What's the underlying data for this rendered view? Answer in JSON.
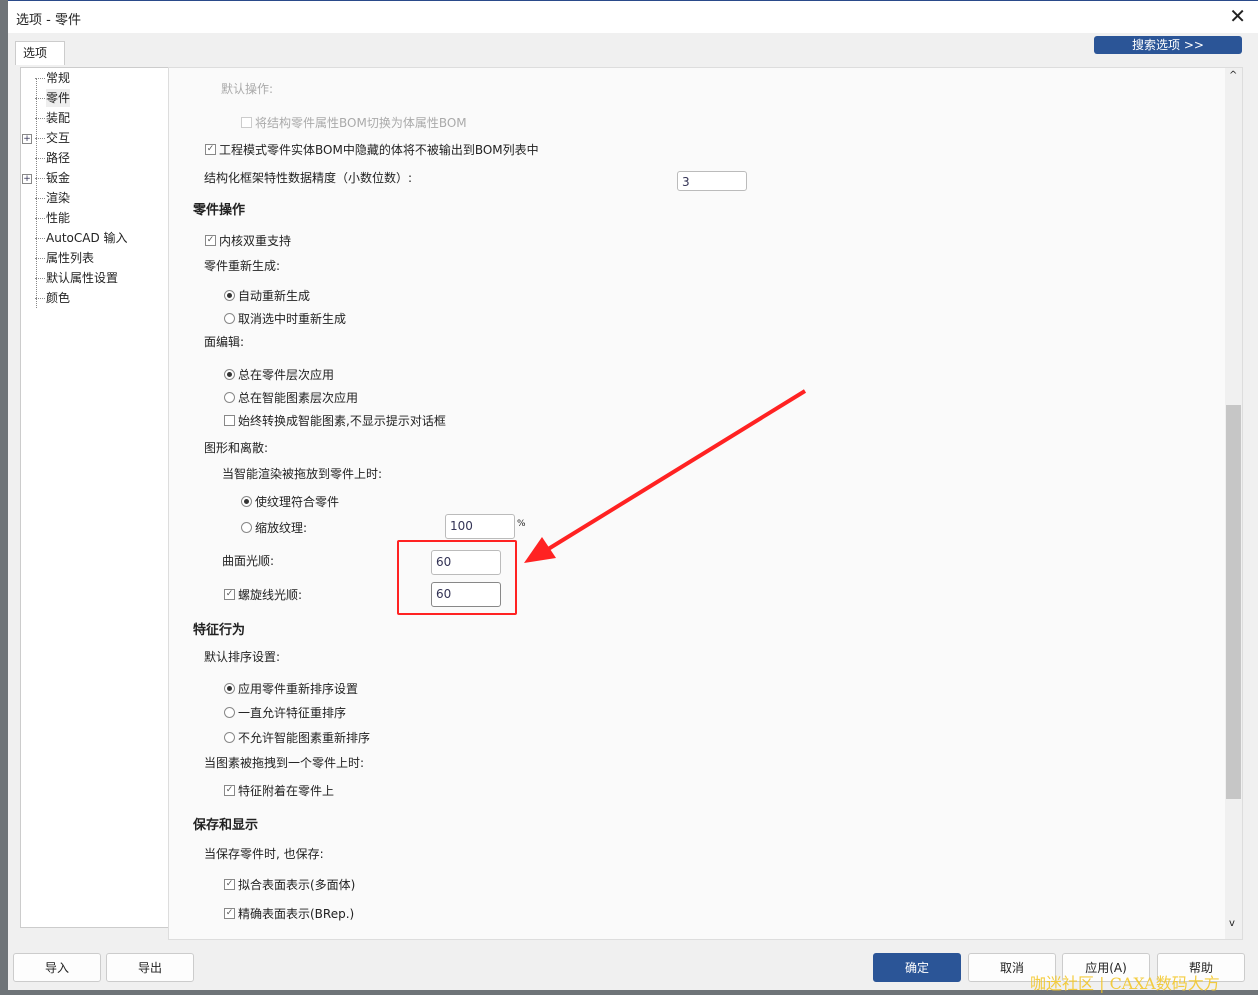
{
  "window": {
    "title": "选项 - 零件",
    "tab": "选项",
    "search_button": "搜索选项 >>"
  },
  "sidebar": {
    "items": [
      {
        "label": "常规",
        "expandable": false
      },
      {
        "label": "零件",
        "expandable": false,
        "selected": true
      },
      {
        "label": "装配",
        "expandable": false
      },
      {
        "label": "交互",
        "expandable": true
      },
      {
        "label": "路径",
        "expandable": false
      },
      {
        "label": "钣金",
        "expandable": true
      },
      {
        "label": "渲染",
        "expandable": false
      },
      {
        "label": "性能",
        "expandable": false
      },
      {
        "label": "AutoCAD 输入",
        "expandable": false
      },
      {
        "label": "属性列表",
        "expandable": false
      },
      {
        "label": "默认属性设置",
        "expandable": false
      },
      {
        "label": "颜色",
        "expandable": false
      }
    ]
  },
  "main": {
    "default_op": "默认操作:",
    "bom_switch": "将结构零件属性BOM切换为体属性BOM",
    "bom_hidden": "工程模式零件实体BOM中隐藏的体将不被输出到BOM列表中",
    "precision_label": "结构化框架特性数据精度（小数位数）:",
    "precision_value": "3",
    "part_ops": "零件操作",
    "dual_kernel": "内核双重支持",
    "regen": "零件重新生成:",
    "regen_auto": "自动重新生成",
    "regen_deselect": "取消选中时重新生成",
    "face_edit": "面编辑:",
    "face_part": "总在零件层次应用",
    "face_smart": "总在智能图素层次应用",
    "face_convert": "始终转换成智能图素,不显示提示对话框",
    "shape": "图形和离散:",
    "drop_render": "当智能渲染被拖放到零件上时:",
    "fit_texture": "使纹理符合零件",
    "scale_texture": "缩放纹理:",
    "scale_value": "100",
    "percent": "%",
    "surface_smooth": "曲面光顺:",
    "surface_value": "60",
    "helix_smooth": "螺旋线光顺:",
    "helix_value": "60",
    "feature": "特征行为",
    "sort": "默认排序设置:",
    "sort_apply": "应用零件重新排序设置",
    "sort_allow": "一直允许特征重排序",
    "sort_disallow": "不允许智能图素重新排序",
    "drag_onto": "当图素被拖拽到一个零件上时:",
    "attach": "特征附着在零件上",
    "save_display": "保存和显示",
    "save_also": "当保存零件时, 也保存:",
    "faceted": "拟合表面表示(多面体)",
    "brep": "精确表面表示(BRep.)"
  },
  "buttons": {
    "import": "导入",
    "export": "导出",
    "ok": "确定",
    "cancel": "取消",
    "apply": "应用(A)",
    "help": "帮助"
  },
  "watermark": "咖迷社区 | CAXA数码大方"
}
